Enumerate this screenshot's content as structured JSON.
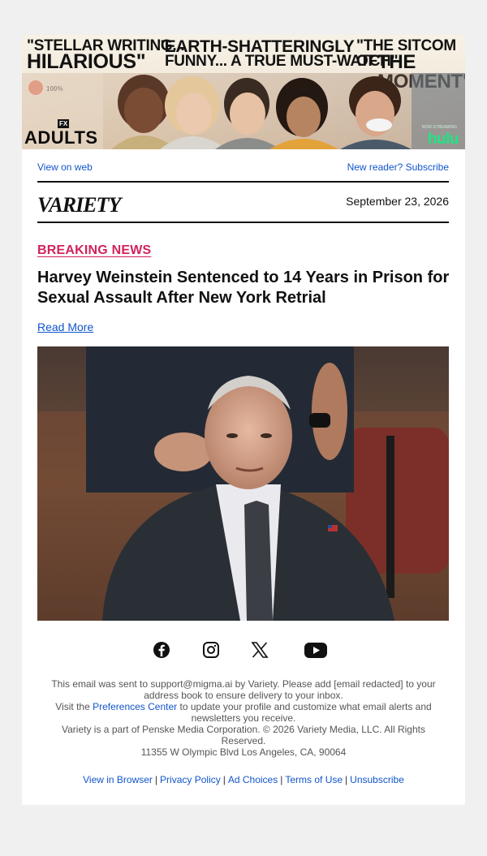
{
  "banner": {
    "quote1_line1": "\"STELLAR WRITING...",
    "quote1_line2": "HILARIOUS\"",
    "quote2_line1": "\"EARTH-SHATTERINGLY",
    "quote2_line2": "FUNNY... A TRUE MUST-WATCH\"",
    "quote3_line1": "\"THE SITCOM OF",
    "quote3_line2": "THE MOMENT\"",
    "rt_score": "100%",
    "network": "FX",
    "show_title": "ADULTS",
    "streaming_label": "NOW STREAMING",
    "streamer": "hulu"
  },
  "toplinks": {
    "view_on_web": "View on web",
    "subscribe": "New reader? Subscribe"
  },
  "masthead": {
    "logo": "VARIETY",
    "date": "September 23, 2026"
  },
  "article": {
    "kicker": "BREAKING NEWS",
    "headline": "Harvey Weinstein Sentenced to 14 Years in Prison for Sexual Assault After New York Retrial",
    "read_more": "Read More"
  },
  "social": {
    "icons": [
      "facebook-icon",
      "instagram-icon",
      "x-icon",
      "youtube-icon"
    ]
  },
  "footer": {
    "line1": "This email was sent to support@migma.ai by Variety. Please add [email redacted] to your address book to ensure delivery to your inbox.",
    "visit_prefix": "Visit the ",
    "preferences_link": "Preferences Center",
    "visit_suffix": " to update your profile and customize what email alerts and newsletters you receive.",
    "line3": "Variety is a part of Penske Media Corporation. © 2026 Variety Media, LLC. All Rights Reserved.",
    "address": "11355 W Olympic Blvd Los Angeles, CA, 90064"
  },
  "bottom_links": {
    "view_in_browser": "View in Browser",
    "privacy": "Privacy Policy",
    "ad_choices": "Ad Choices",
    "terms": "Terms of Use",
    "unsubscribe": "Unsubscribe",
    "separator": "|"
  },
  "colors": {
    "page_bg": "#f0f0f0",
    "card_bg": "#ffffff",
    "link": "#1155cc",
    "kicker": "#d0245b",
    "hulu_green": "#1ce783"
  }
}
